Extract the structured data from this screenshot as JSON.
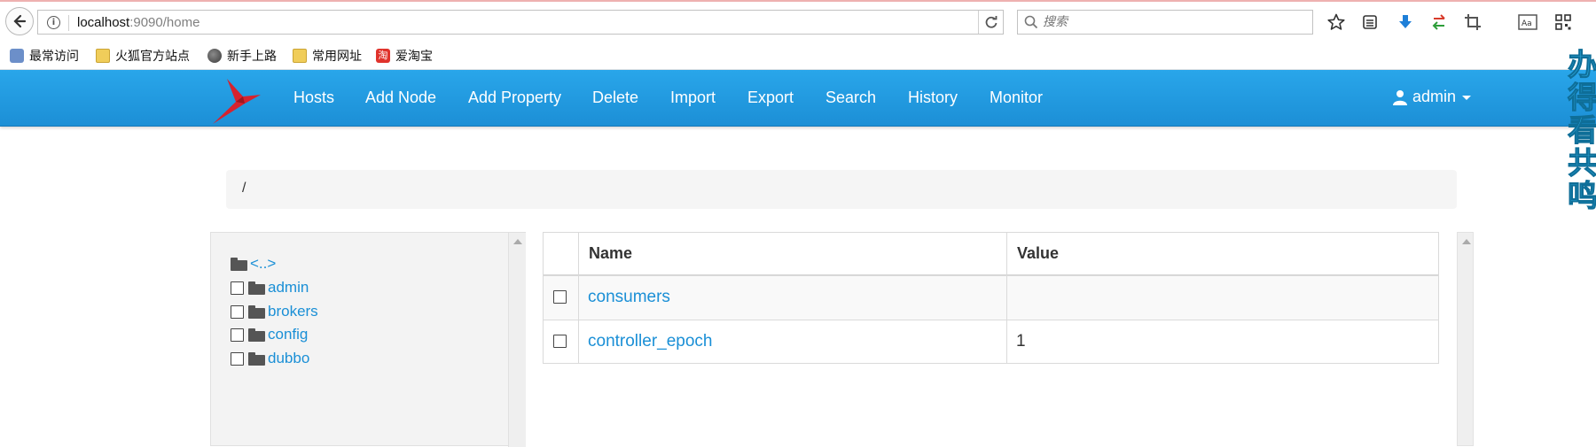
{
  "browser": {
    "url_host": "localhost",
    "url_rest": ":9090/home",
    "search_placeholder": "搜索",
    "toolbar_icons": [
      "star-icon",
      "reading-list-icon",
      "download-icon",
      "sync-icon",
      "crop-icon",
      "reader-icon",
      "qr-code-icon"
    ]
  },
  "bookmarks": [
    {
      "label": "最常访问",
      "icon": "most-visited-icon"
    },
    {
      "label": "火狐官方站点",
      "icon": "folder-icon"
    },
    {
      "label": "新手上路",
      "icon": "globe-icon"
    },
    {
      "label": "常用网址",
      "icon": "folder-icon"
    },
    {
      "label": "爱淘宝",
      "icon": "taobao-icon",
      "icon_text": "淘"
    }
  ],
  "navbar": {
    "items": [
      "Hosts",
      "Add Node",
      "Add Property",
      "Delete",
      "Import",
      "Export",
      "Search",
      "History",
      "Monitor"
    ],
    "user": "admin",
    "colors": {
      "bar": "#1f96dd",
      "logo": "#d6232f"
    }
  },
  "breadcrumb": {
    "path": "/"
  },
  "tree": {
    "parent_label": "<..>",
    "nodes": [
      {
        "label": "admin"
      },
      {
        "label": "brokers"
      },
      {
        "label": "config"
      },
      {
        "label": "dubbo"
      }
    ]
  },
  "table": {
    "headers": {
      "name": "Name",
      "value": "Value"
    },
    "rows": [
      {
        "name": "consumers",
        "value": ""
      },
      {
        "name": "controller_epoch",
        "value": "1"
      }
    ]
  },
  "overlay": {
    "side_text": "办得看共鸣"
  }
}
